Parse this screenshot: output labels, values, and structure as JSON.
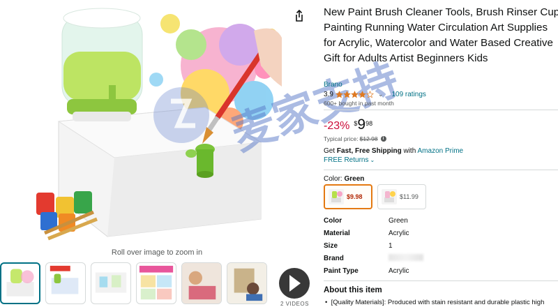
{
  "product": {
    "title": "New Paint Brush Cleaner Tools, Brush Rinser Cup Painting Running Water Circulation Art Supplies for Acrylic, Watercolor and Water Based Creative Gift for Adults Artist Beginners Kids",
    "brand": "Brano",
    "rating": "3.9",
    "rating_fraction": 0.78,
    "ratings_count": "109 ratings",
    "bought": "600+ bought in past month"
  },
  "price": {
    "discount": "-23%",
    "symbol": "$",
    "whole": "9",
    "fraction": "98",
    "typical_label": "Typical price:",
    "typical_value": "$12.98"
  },
  "shipping": {
    "get": "Get",
    "fast": "Fast, Free Shipping",
    "with": "with",
    "prime": "Amazon Prime",
    "returns": "FREE Returns"
  },
  "variants": {
    "label": "Color:",
    "selected_name": "Green",
    "options": [
      {
        "price": "$9.98"
      },
      {
        "price": "$11.99"
      }
    ]
  },
  "specs": [
    {
      "key": "Color",
      "value": "Green"
    },
    {
      "key": "Material",
      "value": "Acrylic"
    },
    {
      "key": "Size",
      "value": "1"
    },
    {
      "key": "Brand",
      "value": ""
    },
    {
      "key": "Paint Type",
      "value": "Acrylic"
    }
  ],
  "about": {
    "title": "About this item",
    "items": [
      "[Quality Materials]: Produced with stain resistant and durable plastic high"
    ]
  },
  "gallery": {
    "zoom_hint": "Roll over image to zoom in",
    "video_label": "2 VIDEOS",
    "watermark": "麦家支持"
  },
  "colors": {
    "link": "#007185",
    "discount": "#cc0c39",
    "star": "#de7921",
    "selected_border": "#e47911",
    "selected_thumb": "#007185"
  }
}
